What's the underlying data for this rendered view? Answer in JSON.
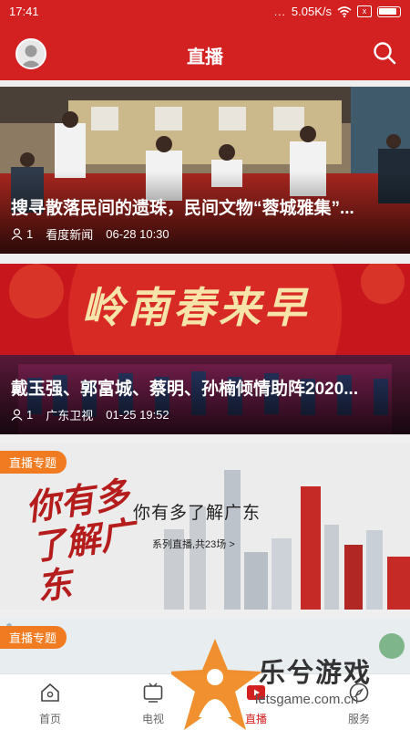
{
  "status_bar": {
    "time": "17:41",
    "signal": "...",
    "speed": "5.05K/s",
    "wifi_icon": "wifi-icon",
    "sim_icon": "x",
    "battery_icon": "battery-icon"
  },
  "header": {
    "title": "直播",
    "avatar_icon": "user-avatar",
    "search_icon": "search-icon",
    "background": "#d32122"
  },
  "feed": [
    {
      "headline": "搜寻散落民间的遗珠，民间文物“蓉城雅集”...",
      "viewers": "1",
      "source": "看度新闻",
      "time": "06-28 10:30"
    },
    {
      "headline": "戴玉强、郭富城、蔡明、孙楠倾情助阵2020...",
      "viewers": "1",
      "source": "广东卫视",
      "time": "01-25 19:52",
      "banner_text": "岭南春来早"
    },
    {
      "tag": "直播专题",
      "title": "你有多了解广东",
      "subtitle": "系列直播,共23场 >",
      "art_text": "你有多了解广东"
    },
    {
      "tag": "直播专题"
    }
  ],
  "tabs": [
    {
      "label": "首页",
      "icon": "home-icon"
    },
    {
      "label": "电视",
      "icon": "tv-icon"
    },
    {
      "label": "直播",
      "icon": "live-icon"
    },
    {
      "label": "",
      "icon": "plus-icon"
    },
    {
      "label": "服务",
      "icon": "compass-icon"
    }
  ],
  "watermark": {
    "text": "乐兮游戏",
    "url": "letsgame.com.cn"
  },
  "colors": {
    "accent": "#d32122",
    "tag": "#f07b21",
    "active_tab": "#d32122"
  }
}
